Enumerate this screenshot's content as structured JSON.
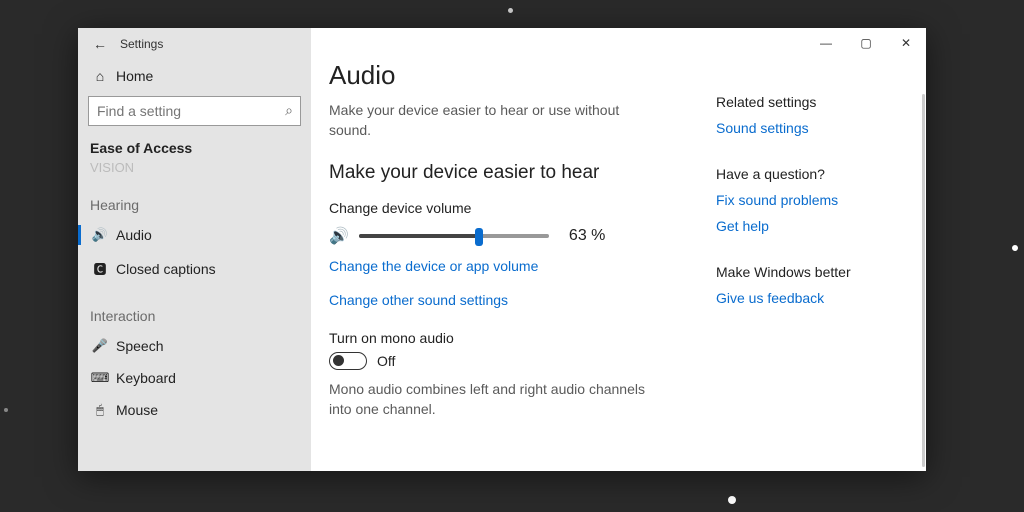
{
  "window": {
    "title": "Settings"
  },
  "sidebar": {
    "home": "Home",
    "search_placeholder": "Find a setting",
    "section": "Ease of Access",
    "prev_cut": "Vision",
    "group_hearing": "Hearing",
    "items_hearing": [
      {
        "icon": "🔊",
        "label": "Audio",
        "active": true
      },
      {
        "icon": "🅲",
        "label": "Closed captions",
        "active": false
      }
    ],
    "group_interaction": "Interaction",
    "items_interaction": [
      {
        "icon": "🎤",
        "label": "Speech"
      },
      {
        "icon": "⌨",
        "label": "Keyboard"
      },
      {
        "icon": "🖱",
        "label": "Mouse"
      }
    ]
  },
  "main": {
    "title": "Audio",
    "desc": "Make your device easier to hear or use without sound.",
    "section1": "Make your device easier to hear",
    "volume_label": "Change device volume",
    "volume_percent": 63,
    "volume_display": "63 %",
    "link_app_volume": "Change the device or app volume",
    "link_other_sound": "Change other sound settings",
    "mono_title": "Turn on mono audio",
    "mono_state": "Off",
    "mono_desc": "Mono audio combines left and right audio channels into one channel."
  },
  "aside": {
    "related_title": "Related settings",
    "related_link": "Sound settings",
    "question_title": "Have a question?",
    "question_link1": "Fix sound problems",
    "question_link2": "Get help",
    "better_title": "Make Windows better",
    "better_link": "Give us feedback"
  }
}
